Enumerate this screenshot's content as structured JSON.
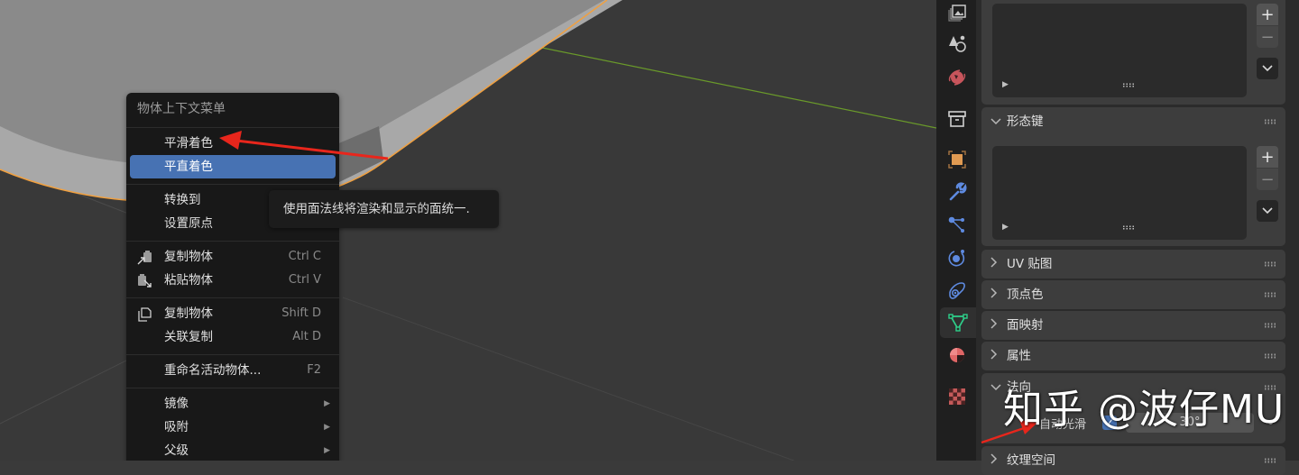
{
  "context_menu": {
    "title": "物体上下文菜单",
    "items": [
      {
        "label": "平滑着色",
        "shortcut": "",
        "icon": "",
        "submenu": false,
        "active": false
      },
      {
        "label": "平直着色",
        "shortcut": "",
        "icon": "",
        "submenu": false,
        "active": true
      },
      {
        "label": "转换到",
        "shortcut": "",
        "icon": "",
        "submenu": false,
        "active": false
      },
      {
        "label": "设置原点",
        "shortcut": "",
        "icon": "",
        "submenu": false,
        "active": false
      },
      {
        "label": "复制物体",
        "shortcut": "Ctrl C",
        "icon": "copy-to-clipboard-icon",
        "submenu": false,
        "active": false
      },
      {
        "label": "粘贴物体",
        "shortcut": "Ctrl V",
        "icon": "paste-from-clipboard-icon",
        "submenu": false,
        "active": false
      },
      {
        "label": "复制物体",
        "shortcut": "Shift D",
        "icon": "duplicate-icon",
        "submenu": false,
        "active": false
      },
      {
        "label": "关联复制",
        "shortcut": "Alt D",
        "icon": "",
        "submenu": false,
        "active": false
      },
      {
        "label": "重命名活动物体...",
        "shortcut": "F2",
        "icon": "",
        "submenu": false,
        "active": false
      },
      {
        "label": "镜像",
        "shortcut": "",
        "icon": "",
        "submenu": true,
        "active": false
      },
      {
        "label": "吸附",
        "shortcut": "",
        "icon": "",
        "submenu": true,
        "active": false
      },
      {
        "label": "父级",
        "shortcut": "",
        "icon": "",
        "submenu": true,
        "active": false
      }
    ],
    "submenu_arrow": "▶"
  },
  "tooltip": {
    "text": "使用面法线将渲染和显示的面统一."
  },
  "properties_tabs": [
    {
      "name": "view-layer",
      "icon": "image-stack-icon",
      "color": "#c8c8c8",
      "active": false
    },
    {
      "name": "scene",
      "icon": "scene-icon",
      "color": "#c8c8c8",
      "active": false
    },
    {
      "name": "world",
      "icon": "world-icon",
      "color": "#c8555c",
      "active": false
    },
    {
      "name": "collection",
      "icon": "collection-box-icon",
      "color": "#d0d0d0",
      "active": false
    },
    {
      "name": "object",
      "icon": "object-square-icon",
      "color": "#e09a52",
      "active": false
    },
    {
      "name": "modifiers",
      "icon": "wrench-icon",
      "color": "#5e8ae0",
      "active": false
    },
    {
      "name": "particles",
      "icon": "particles-icon",
      "color": "#5e8ae0",
      "active": false
    },
    {
      "name": "physics",
      "icon": "physics-orbit-icon",
      "color": "#5e8ae0",
      "active": false
    },
    {
      "name": "constraints",
      "icon": "constraint-icon",
      "color": "#5e8ae0",
      "active": false
    },
    {
      "name": "data",
      "icon": "mesh-triangle-icon",
      "color": "#2ecf8a",
      "active": true
    },
    {
      "name": "material",
      "icon": "material-sphere-icon",
      "color": "#e06666",
      "active": false
    },
    {
      "name": "texture",
      "icon": "checker-texture-icon",
      "color": "#d66a6a",
      "active": false
    }
  ],
  "properties": {
    "vertex_groups_list": {
      "add_label": "+",
      "remove_label": "−",
      "menu_label": "⌄",
      "play_label": "▶"
    },
    "panels": [
      {
        "id": "shape-keys",
        "label": "形态键",
        "expanded": true,
        "chevron": "⌄"
      },
      {
        "id": "uv-maps",
        "label": "UV 贴图",
        "expanded": false,
        "chevron": "›"
      },
      {
        "id": "vertex-colors",
        "label": "顶点色",
        "expanded": false,
        "chevron": "›"
      },
      {
        "id": "face-maps",
        "label": "面映射",
        "expanded": false,
        "chevron": "›"
      },
      {
        "id": "attributes",
        "label": "属性",
        "expanded": false,
        "chevron": "›"
      },
      {
        "id": "normals",
        "label": "法向",
        "expanded": true,
        "chevron": "⌄"
      },
      {
        "id": "texture-space",
        "label": "纹理空间",
        "expanded": false,
        "chevron": "›"
      }
    ],
    "shape_keys_list": {
      "add_label": "+",
      "remove_label": "−",
      "menu_label": "⌄",
      "play_label": "▶"
    },
    "normals": {
      "auto_smooth_label": "自动光滑",
      "auto_smooth_checked": true,
      "check_mark": "✓",
      "angle_value": "30°"
    }
  },
  "watermark": "知乎 @波仔MU",
  "colors": {
    "accent_blue": "#4772b3",
    "selection_orange": "#f0a040",
    "axis_green": "#6a9a2a",
    "annotation_red": "#e8261c"
  }
}
